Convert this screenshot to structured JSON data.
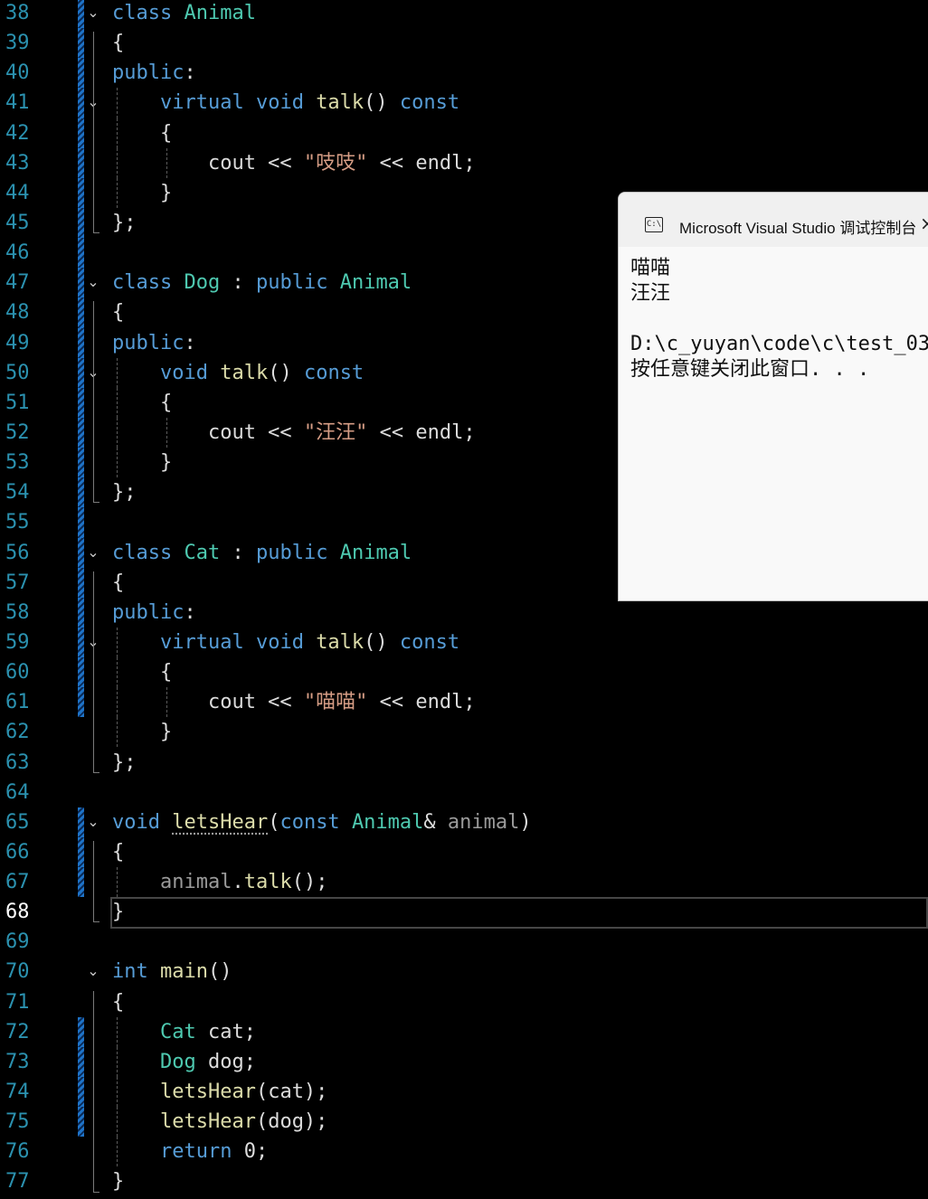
{
  "editor": {
    "active_line": 68,
    "lines": [
      {
        "n": "38",
        "tokens": [
          [
            "kw",
            "class "
          ],
          [
            "ty",
            "Animal"
          ]
        ]
      },
      {
        "n": "39",
        "tokens": [
          [
            "pl",
            "{"
          ]
        ]
      },
      {
        "n": "40",
        "tokens": [
          [
            "kw",
            "public"
          ],
          [
            "pl",
            ":"
          ]
        ]
      },
      {
        "n": "41",
        "tokens": [
          [
            "pl",
            "    "
          ],
          [
            "kw",
            "virtual "
          ],
          [
            "kw",
            "void "
          ],
          [
            "fn",
            "talk"
          ],
          [
            "pl",
            "() "
          ],
          [
            "kw",
            "const"
          ]
        ]
      },
      {
        "n": "42",
        "tokens": [
          [
            "pl",
            "    {"
          ]
        ]
      },
      {
        "n": "43",
        "tokens": [
          [
            "pl",
            "        cout << "
          ],
          [
            "st",
            "\"吱吱\""
          ],
          [
            "pl",
            " << endl;"
          ]
        ]
      },
      {
        "n": "44",
        "tokens": [
          [
            "pl",
            "    }"
          ]
        ]
      },
      {
        "n": "45",
        "tokens": [
          [
            "pl",
            "};"
          ]
        ]
      },
      {
        "n": "46",
        "tokens": []
      },
      {
        "n": "47",
        "tokens": [
          [
            "kw",
            "class "
          ],
          [
            "ty",
            "Dog"
          ],
          [
            "pl",
            " : "
          ],
          [
            "kw",
            "public "
          ],
          [
            "ty",
            "Animal"
          ]
        ]
      },
      {
        "n": "48",
        "tokens": [
          [
            "pl",
            "{"
          ]
        ]
      },
      {
        "n": "49",
        "tokens": [
          [
            "kw",
            "public"
          ],
          [
            "pl",
            ":"
          ]
        ]
      },
      {
        "n": "50",
        "tokens": [
          [
            "pl",
            "    "
          ],
          [
            "kw",
            "void "
          ],
          [
            "fn",
            "talk"
          ],
          [
            "pl",
            "() "
          ],
          [
            "kw",
            "const"
          ]
        ]
      },
      {
        "n": "51",
        "tokens": [
          [
            "pl",
            "    {"
          ]
        ]
      },
      {
        "n": "52",
        "tokens": [
          [
            "pl",
            "        cout << "
          ],
          [
            "st",
            "\"汪汪\""
          ],
          [
            "pl",
            " << endl;"
          ]
        ]
      },
      {
        "n": "53",
        "tokens": [
          [
            "pl",
            "    }"
          ]
        ]
      },
      {
        "n": "54",
        "tokens": [
          [
            "pl",
            "};"
          ]
        ]
      },
      {
        "n": "55",
        "tokens": []
      },
      {
        "n": "56",
        "tokens": [
          [
            "kw",
            "class "
          ],
          [
            "ty",
            "Cat"
          ],
          [
            "pl",
            " : "
          ],
          [
            "kw",
            "public "
          ],
          [
            "ty",
            "Animal"
          ]
        ]
      },
      {
        "n": "57",
        "tokens": [
          [
            "pl",
            "{"
          ]
        ]
      },
      {
        "n": "58",
        "tokens": [
          [
            "kw",
            "public"
          ],
          [
            "pl",
            ":"
          ]
        ]
      },
      {
        "n": "59",
        "tokens": [
          [
            "pl",
            "    "
          ],
          [
            "kw",
            "virtual "
          ],
          [
            "kw",
            "void "
          ],
          [
            "fn",
            "talk"
          ],
          [
            "pl",
            "() "
          ],
          [
            "kw",
            "const"
          ]
        ]
      },
      {
        "n": "60",
        "tokens": [
          [
            "pl",
            "    {"
          ]
        ]
      },
      {
        "n": "61",
        "tokens": [
          [
            "pl",
            "        cout << "
          ],
          [
            "st",
            "\"喵喵\""
          ],
          [
            "pl",
            " << endl;"
          ]
        ]
      },
      {
        "n": "62",
        "tokens": [
          [
            "pl",
            "    }"
          ]
        ]
      },
      {
        "n": "63",
        "tokens": [
          [
            "pl",
            "};"
          ]
        ]
      },
      {
        "n": "64",
        "tokens": []
      },
      {
        "n": "65",
        "tokens": [
          [
            "kw",
            "void "
          ],
          [
            "fn",
            "letsHear"
          ],
          [
            "pl",
            "("
          ],
          [
            "kw",
            "const "
          ],
          [
            "ty",
            "Animal"
          ],
          [
            "pl",
            "& "
          ],
          [
            "pm",
            "animal"
          ],
          [
            "pl",
            ")"
          ]
        ]
      },
      {
        "n": "66",
        "tokens": [
          [
            "pl",
            "{"
          ]
        ]
      },
      {
        "n": "67",
        "tokens": [
          [
            "pl",
            "    "
          ],
          [
            "pm",
            "animal"
          ],
          [
            "pl",
            "."
          ],
          [
            "fn",
            "talk"
          ],
          [
            "pl",
            "();"
          ]
        ]
      },
      {
        "n": "68",
        "tokens": [
          [
            "pl",
            "}"
          ]
        ]
      },
      {
        "n": "69",
        "tokens": []
      },
      {
        "n": "70",
        "tokens": [
          [
            "kw",
            "int "
          ],
          [
            "fn",
            "main"
          ],
          [
            "pl",
            "()"
          ]
        ]
      },
      {
        "n": "71",
        "tokens": [
          [
            "pl",
            "{"
          ]
        ]
      },
      {
        "n": "72",
        "tokens": [
          [
            "pl",
            "    "
          ],
          [
            "ty",
            "Cat"
          ],
          [
            "pl",
            " cat;"
          ]
        ]
      },
      {
        "n": "73",
        "tokens": [
          [
            "pl",
            "    "
          ],
          [
            "ty",
            "Dog"
          ],
          [
            "pl",
            " dog;"
          ]
        ]
      },
      {
        "n": "74",
        "tokens": [
          [
            "pl",
            "    "
          ],
          [
            "fn",
            "letsHear"
          ],
          [
            "pl",
            "(cat);"
          ]
        ]
      },
      {
        "n": "75",
        "tokens": [
          [
            "pl",
            "    "
          ],
          [
            "fn",
            "letsHear"
          ],
          [
            "pl",
            "(dog);"
          ]
        ]
      },
      {
        "n": "76",
        "tokens": [
          [
            "pl",
            "    "
          ],
          [
            "kw",
            "return "
          ],
          [
            "pl",
            "0;"
          ]
        ]
      },
      {
        "n": "77",
        "tokens": [
          [
            "pl",
            "}"
          ]
        ]
      }
    ]
  },
  "console": {
    "icon": "C:\\",
    "title": "Microsoft Visual Studio 调试控制台",
    "close_icon": "×",
    "output": [
      "喵喵",
      "汪汪",
      "",
      "D:\\c_yuyan\\code\\c\\test_03",
      "按任意键关闭此窗口. . ."
    ]
  }
}
